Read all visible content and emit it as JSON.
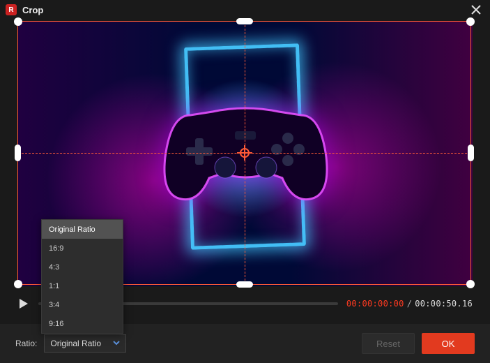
{
  "header": {
    "title": "Crop"
  },
  "playback": {
    "current": "00:00:00:00",
    "separator": "/",
    "duration": "00:00:50.16"
  },
  "ratio": {
    "label": "Ratio:",
    "selected": "Original Ratio",
    "options": [
      "Original Ratio",
      "16:9",
      "4:3",
      "1:1",
      "3:4",
      "9:16"
    ]
  },
  "buttons": {
    "reset": "Reset",
    "ok": "OK"
  },
  "icons": {
    "app": "R"
  }
}
